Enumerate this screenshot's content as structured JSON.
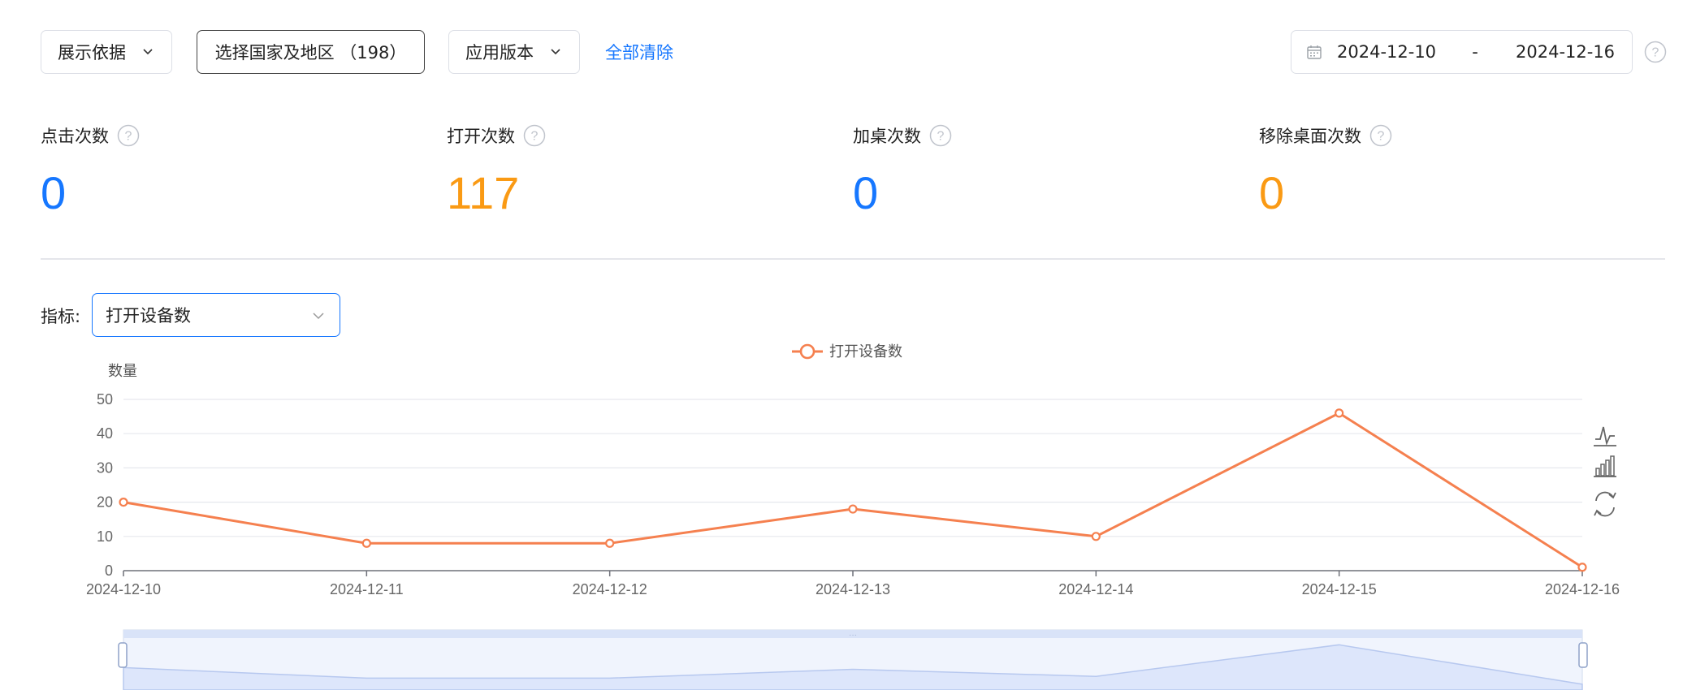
{
  "filters": {
    "basis_label": "展示依据",
    "region_label": "选择国家及地区 （198）",
    "version_label": "应用版本",
    "clear_all": "全部清除"
  },
  "date_range": {
    "start": "2024-12-10",
    "separator": "-",
    "end": "2024-12-16"
  },
  "metrics": [
    {
      "label": "点击次数",
      "value": "0",
      "color": "#1677ff"
    },
    {
      "label": "打开次数",
      "value": "117",
      "color": "#fa9a14"
    },
    {
      "label": "加桌次数",
      "value": "0",
      "color": "#1677ff"
    },
    {
      "label": "移除桌面次数",
      "value": "0",
      "color": "#fa9a14"
    }
  ],
  "indicator": {
    "label": "指标:",
    "selected": "打开设备数"
  },
  "colors": {
    "line": "#f5804f",
    "link": "#1677ff",
    "slider_fill": "#dde6fb"
  },
  "toolbox": {
    "icons": [
      "line-chart-icon",
      "bar-chart-icon",
      "restore-icon"
    ]
  },
  "chart_data": {
    "type": "line",
    "ylabel": "数量",
    "categories": [
      "2024-12-10",
      "2024-12-11",
      "2024-12-12",
      "2024-12-13",
      "2024-12-14",
      "2024-12-15",
      "2024-12-16"
    ],
    "series": [
      {
        "name": "打开设备数",
        "values": [
          20,
          8,
          8,
          18,
          10,
          46,
          1
        ]
      }
    ],
    "ylim": [
      0,
      50
    ],
    "yticks": [
      0,
      10,
      20,
      30,
      40,
      50
    ],
    "grid": true,
    "legend": "top-center",
    "datazoom": true
  }
}
